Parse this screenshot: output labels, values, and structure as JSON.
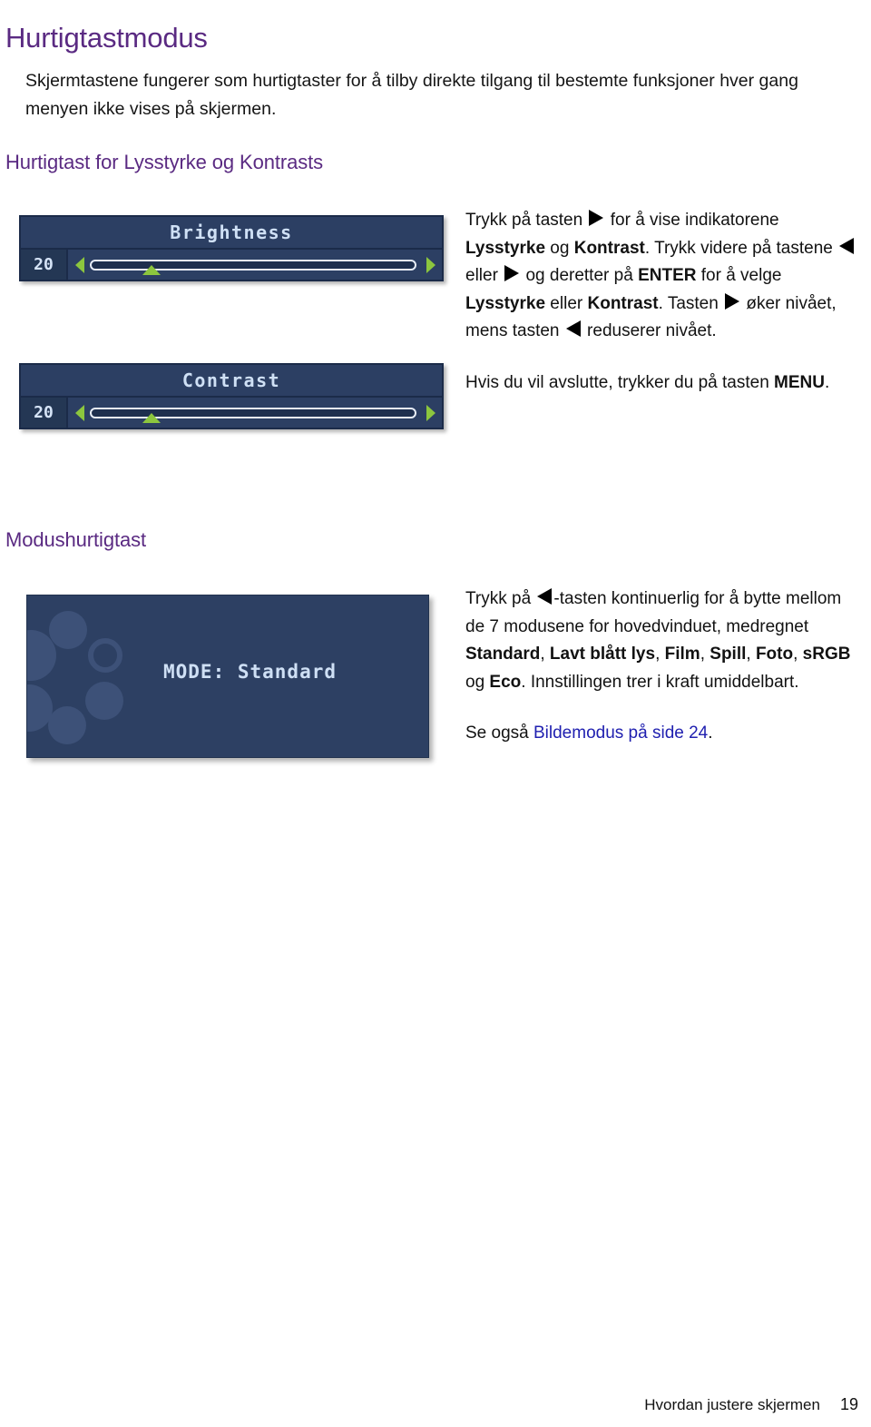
{
  "document": {
    "title": "Hurtigtastmodus",
    "intro": "Skjermtastene fungerer som hurtigtaster for å tilby direkte tilgang til bestemte funksjoner hver gang menyen ikke vises på skjermen."
  },
  "colors": {
    "heading_purple": "#5A2A82",
    "body_black": "#121212",
    "link_blue": "#2020b0",
    "osd_panel_bg": "#2c3f63",
    "osd_panel_border": "#1b2b49",
    "osd_text": "#cfe0f5",
    "osd_accent_green": "#8cc63e",
    "mode_panel_bg": "#2d4063",
    "mode_bubble": "#3d5178"
  },
  "sections": [
    {
      "heading": "Hurtigtast for Lysstyrke og Kontrasts",
      "osd": [
        {
          "name": "brightness",
          "title": "Brightness",
          "value": "20",
          "left_arrow_icon": "triangle-left-icon",
          "right_arrow_icon": "triangle-right-icon",
          "thumb_icon": "triangle-up-icon"
        },
        {
          "name": "contrast",
          "title": "Contrast",
          "value": "20",
          "left_arrow_icon": "triangle-left-icon",
          "right_arrow_icon": "triangle-right-icon",
          "thumb_icon": "triangle-up-icon"
        }
      ],
      "copy": {
        "p1": {
          "s1": "Trykk på tasten ",
          "icon1": "triangle-right-icon",
          "s2": " for å vise indikatorene ",
          "b1": "Lysstyrke",
          "s3": " og ",
          "b2": "Kontrast",
          "s4": ". Trykk videre på tastene ",
          "icon2": "triangle-left-icon",
          "s5": " eller ",
          "icon3": "triangle-right-icon",
          "s6": " og deretter på ",
          "b3": "ENTER",
          "s7": " for å velge ",
          "b4": "Lysstyrke",
          "s8": " eller ",
          "b5": "Kontrast",
          "s9": ". Tasten ",
          "icon4": "triangle-right-icon",
          "s10": " øker nivået, mens tasten ",
          "icon5": "triangle-left-icon",
          "s11": " reduserer nivået."
        },
        "p2": {
          "s1": "Hvis du vil avslutte, trykker du på tasten ",
          "b1": "MENU",
          "s2": "."
        }
      }
    },
    {
      "heading": "Modushurtigtast",
      "mode_panel": {
        "label": "MODE: Standard",
        "mode_key": "MODE:",
        "mode_value": "Standard"
      },
      "copy": {
        "p1": {
          "s1": "Trykk på ",
          "icon1": "triangle-left-icon",
          "s2": "-tasten kontinuerlig for å bytte mellom de 7 modusene for hovedvinduet, medregnet ",
          "b1": "Standard",
          "s3": ", ",
          "b2": "Lavt blått lys",
          "s4": ", ",
          "b3": "Film",
          "s5": ", ",
          "b4": "Spill",
          "s6": ", ",
          "b5": "Foto",
          "s7": ", ",
          "b6": "sRGB",
          "s8": " og ",
          "b7": "Eco",
          "s9": ". Innstillingen trer i kraft umiddelbart."
        },
        "p2": {
          "s1": "Se også ",
          "link": "Bildemodus på side 24",
          "s2": "."
        }
      },
      "modes": [
        "Standard",
        "Lavt blått lys",
        "Film",
        "Spill",
        "Foto",
        "sRGB",
        "Eco"
      ],
      "mode_count": "7"
    }
  ],
  "footer": {
    "chapter": "Hvordan justere skjermen",
    "page_number": "19"
  }
}
